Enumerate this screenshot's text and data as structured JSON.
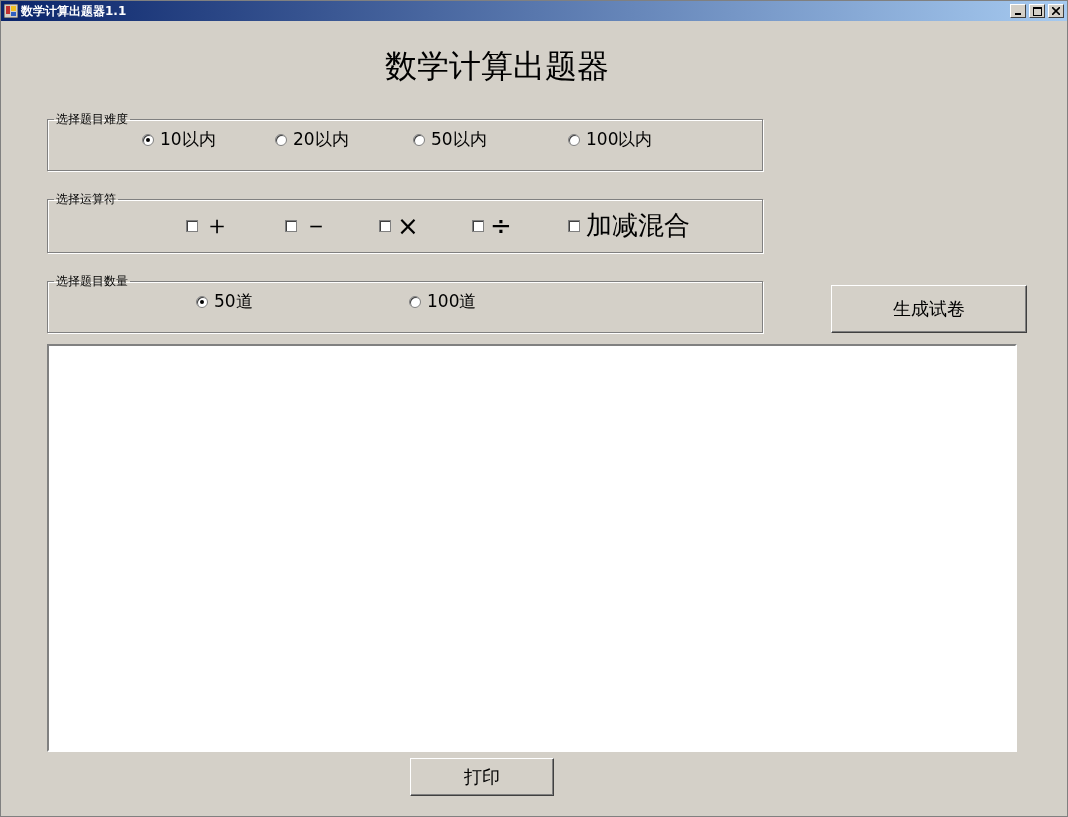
{
  "window": {
    "title": "数学计算出题器1.1"
  },
  "heading": "数学计算出题器",
  "difficulty": {
    "label": "选择题目难度",
    "options": [
      {
        "label": "10以内",
        "selected": true
      },
      {
        "label": "20以内",
        "selected": false
      },
      {
        "label": "50以内",
        "selected": false
      },
      {
        "label": "100以内",
        "selected": false
      }
    ]
  },
  "operators": {
    "label": "选择运算符",
    "options": [
      {
        "label": "＋",
        "checked": false
      },
      {
        "label": "－",
        "checked": false
      },
      {
        "label": "×",
        "checked": false
      },
      {
        "label": "÷",
        "checked": false
      },
      {
        "label": "加减混合",
        "checked": false
      }
    ]
  },
  "count": {
    "label": "选择题目数量",
    "options": [
      {
        "label": "50道",
        "selected": true
      },
      {
        "label": "100道",
        "selected": false
      }
    ]
  },
  "generate_button": "生成试卷",
  "print_button": "打印"
}
